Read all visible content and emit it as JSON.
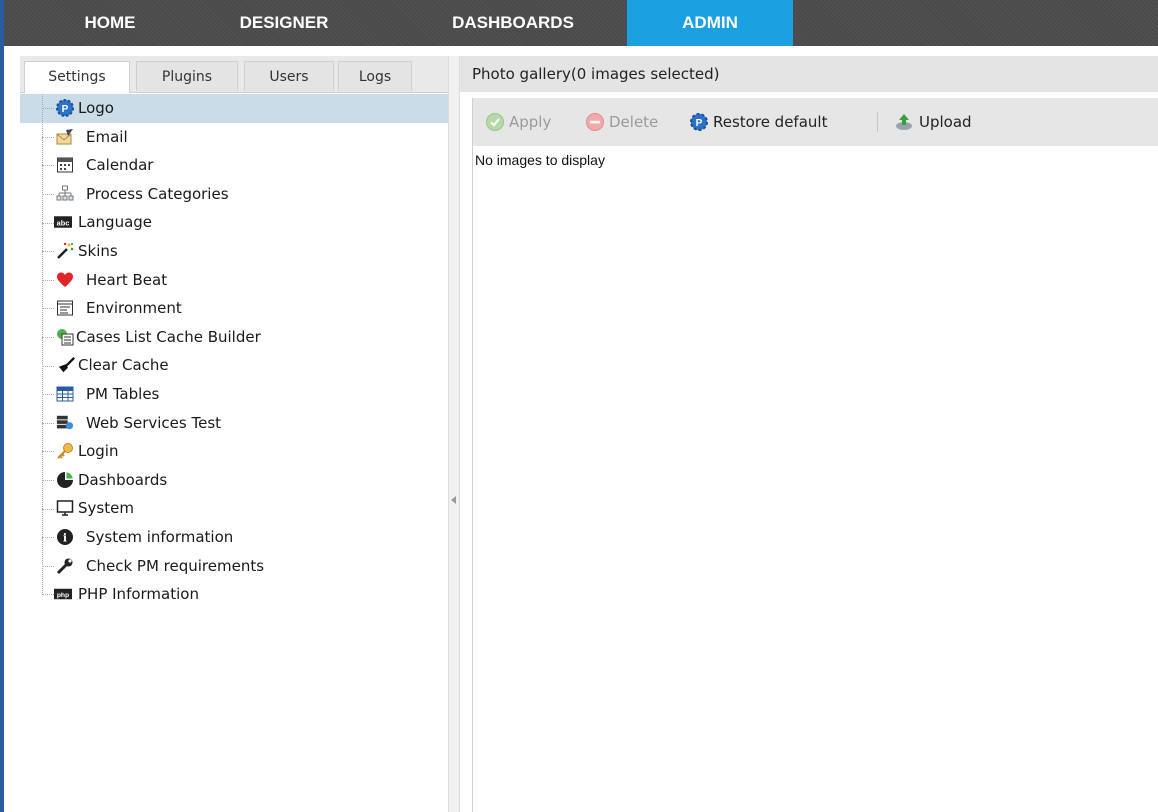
{
  "topnav": {
    "tabs": [
      {
        "label": "HOME",
        "active": false
      },
      {
        "label": "DESIGNER",
        "active": false
      },
      {
        "label": "DASHBOARDS",
        "active": false
      },
      {
        "label": "ADMIN",
        "active": true
      }
    ],
    "active_color": "#1ba0e2"
  },
  "left": {
    "tabs": [
      {
        "label": "Settings",
        "active": true
      },
      {
        "label": "Plugins",
        "active": false
      },
      {
        "label": "Users",
        "active": false
      },
      {
        "label": "Logs",
        "active": false
      }
    ],
    "items": [
      {
        "label": "Logo",
        "icon": "pm-logo-icon",
        "selected": true
      },
      {
        "label": "Email",
        "icon": "email-icon"
      },
      {
        "label": "Calendar",
        "icon": "calendar-icon"
      },
      {
        "label": "Process Categories",
        "icon": "process-categories-icon"
      },
      {
        "label": "Language",
        "icon": "abc-language-icon"
      },
      {
        "label": "Skins",
        "icon": "magic-wand-icon"
      },
      {
        "label": "Heart Beat",
        "icon": "heart-icon"
      },
      {
        "label": "Environment",
        "icon": "environment-icon"
      },
      {
        "label": "Cases List Cache Builder",
        "icon": "cache-builder-icon"
      },
      {
        "label": "Clear Cache",
        "icon": "broom-icon"
      },
      {
        "label": "PM Tables",
        "icon": "table-icon"
      },
      {
        "label": "Web Services Test",
        "icon": "web-services-icon"
      },
      {
        "label": "Login",
        "icon": "key-icon"
      },
      {
        "label": "Dashboards",
        "icon": "dashboard-pie-icon"
      },
      {
        "label": "System",
        "icon": "monitor-icon"
      },
      {
        "label": "System information",
        "icon": "info-icon"
      },
      {
        "label": "Check PM requirements",
        "icon": "wrench-icon"
      },
      {
        "label": "PHP Information",
        "icon": "php-icon"
      }
    ]
  },
  "gallery": {
    "header": "Photo gallery(0 images selected)",
    "toolbar": {
      "apply": "Apply",
      "delete": "Delete",
      "restore": "Restore default",
      "upload": "Upload"
    },
    "empty_text": "No images to display"
  }
}
